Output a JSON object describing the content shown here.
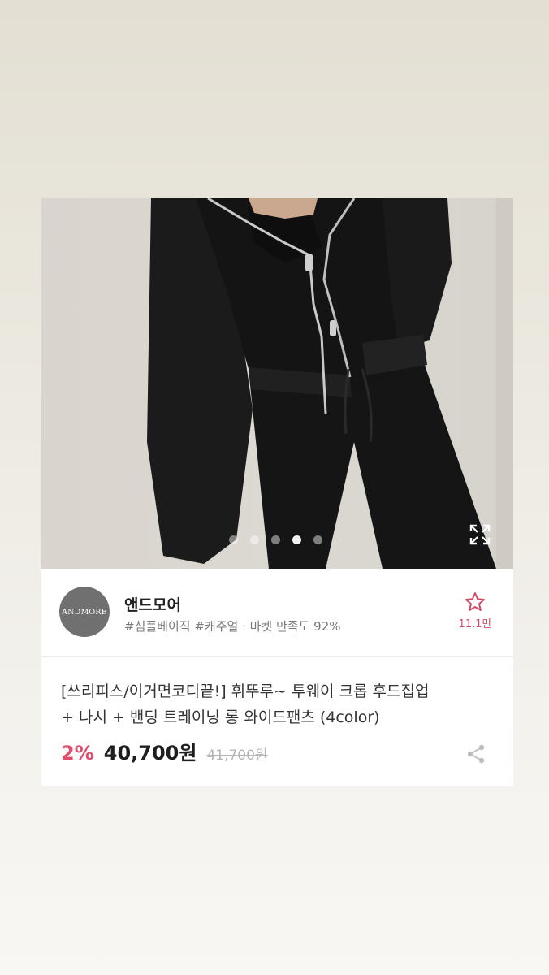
{
  "carousel": {
    "page_count": 5,
    "active_index": 3
  },
  "shop": {
    "logo_text": "ANDMORE",
    "name": "앤드모어",
    "tags_line": "#심플베이직 #캐주얼 · 마켓 만족도 92%"
  },
  "favorite": {
    "count": "11.1만",
    "icon": "star-outline-icon",
    "color": "#d24b67"
  },
  "product": {
    "title_line1": "[쓰리피스/이거면코디끝!] 휘뚜루~ 투웨이 크롭 후드집업",
    "title_line2": "+ 나시 + 밴딩 트레이닝 롱 와이드팬츠 (4color)",
    "discount": "2%",
    "price": "40,700원",
    "original_price": "41,700원"
  },
  "colors": {
    "accent": "#e04e6c",
    "text_primary": "#222222",
    "text_secondary": "#7a7a7a"
  }
}
